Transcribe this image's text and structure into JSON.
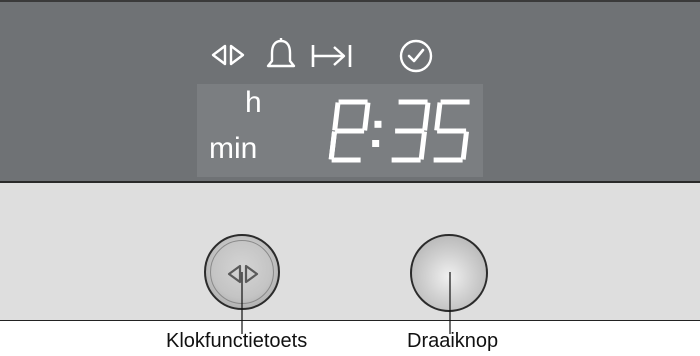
{
  "display": {
    "symbols": [
      "arrows-left-right-icon",
      "bell-icon",
      "arrow-to-bar-icon",
      "clock-icon"
    ],
    "unit_hours": "h",
    "unit_minutes": "min",
    "time": "12:35"
  },
  "controls": {
    "clock_key_label": "Klokfunctietoets",
    "clock_key_icon": "arrows-left-right-icon",
    "rotary_knob_label": "Draaiknop"
  },
  "colors": {
    "panel": "#6f7275",
    "display_window": "#7b7e81",
    "segment": "#ffffff",
    "control_strip": "#dedede"
  }
}
